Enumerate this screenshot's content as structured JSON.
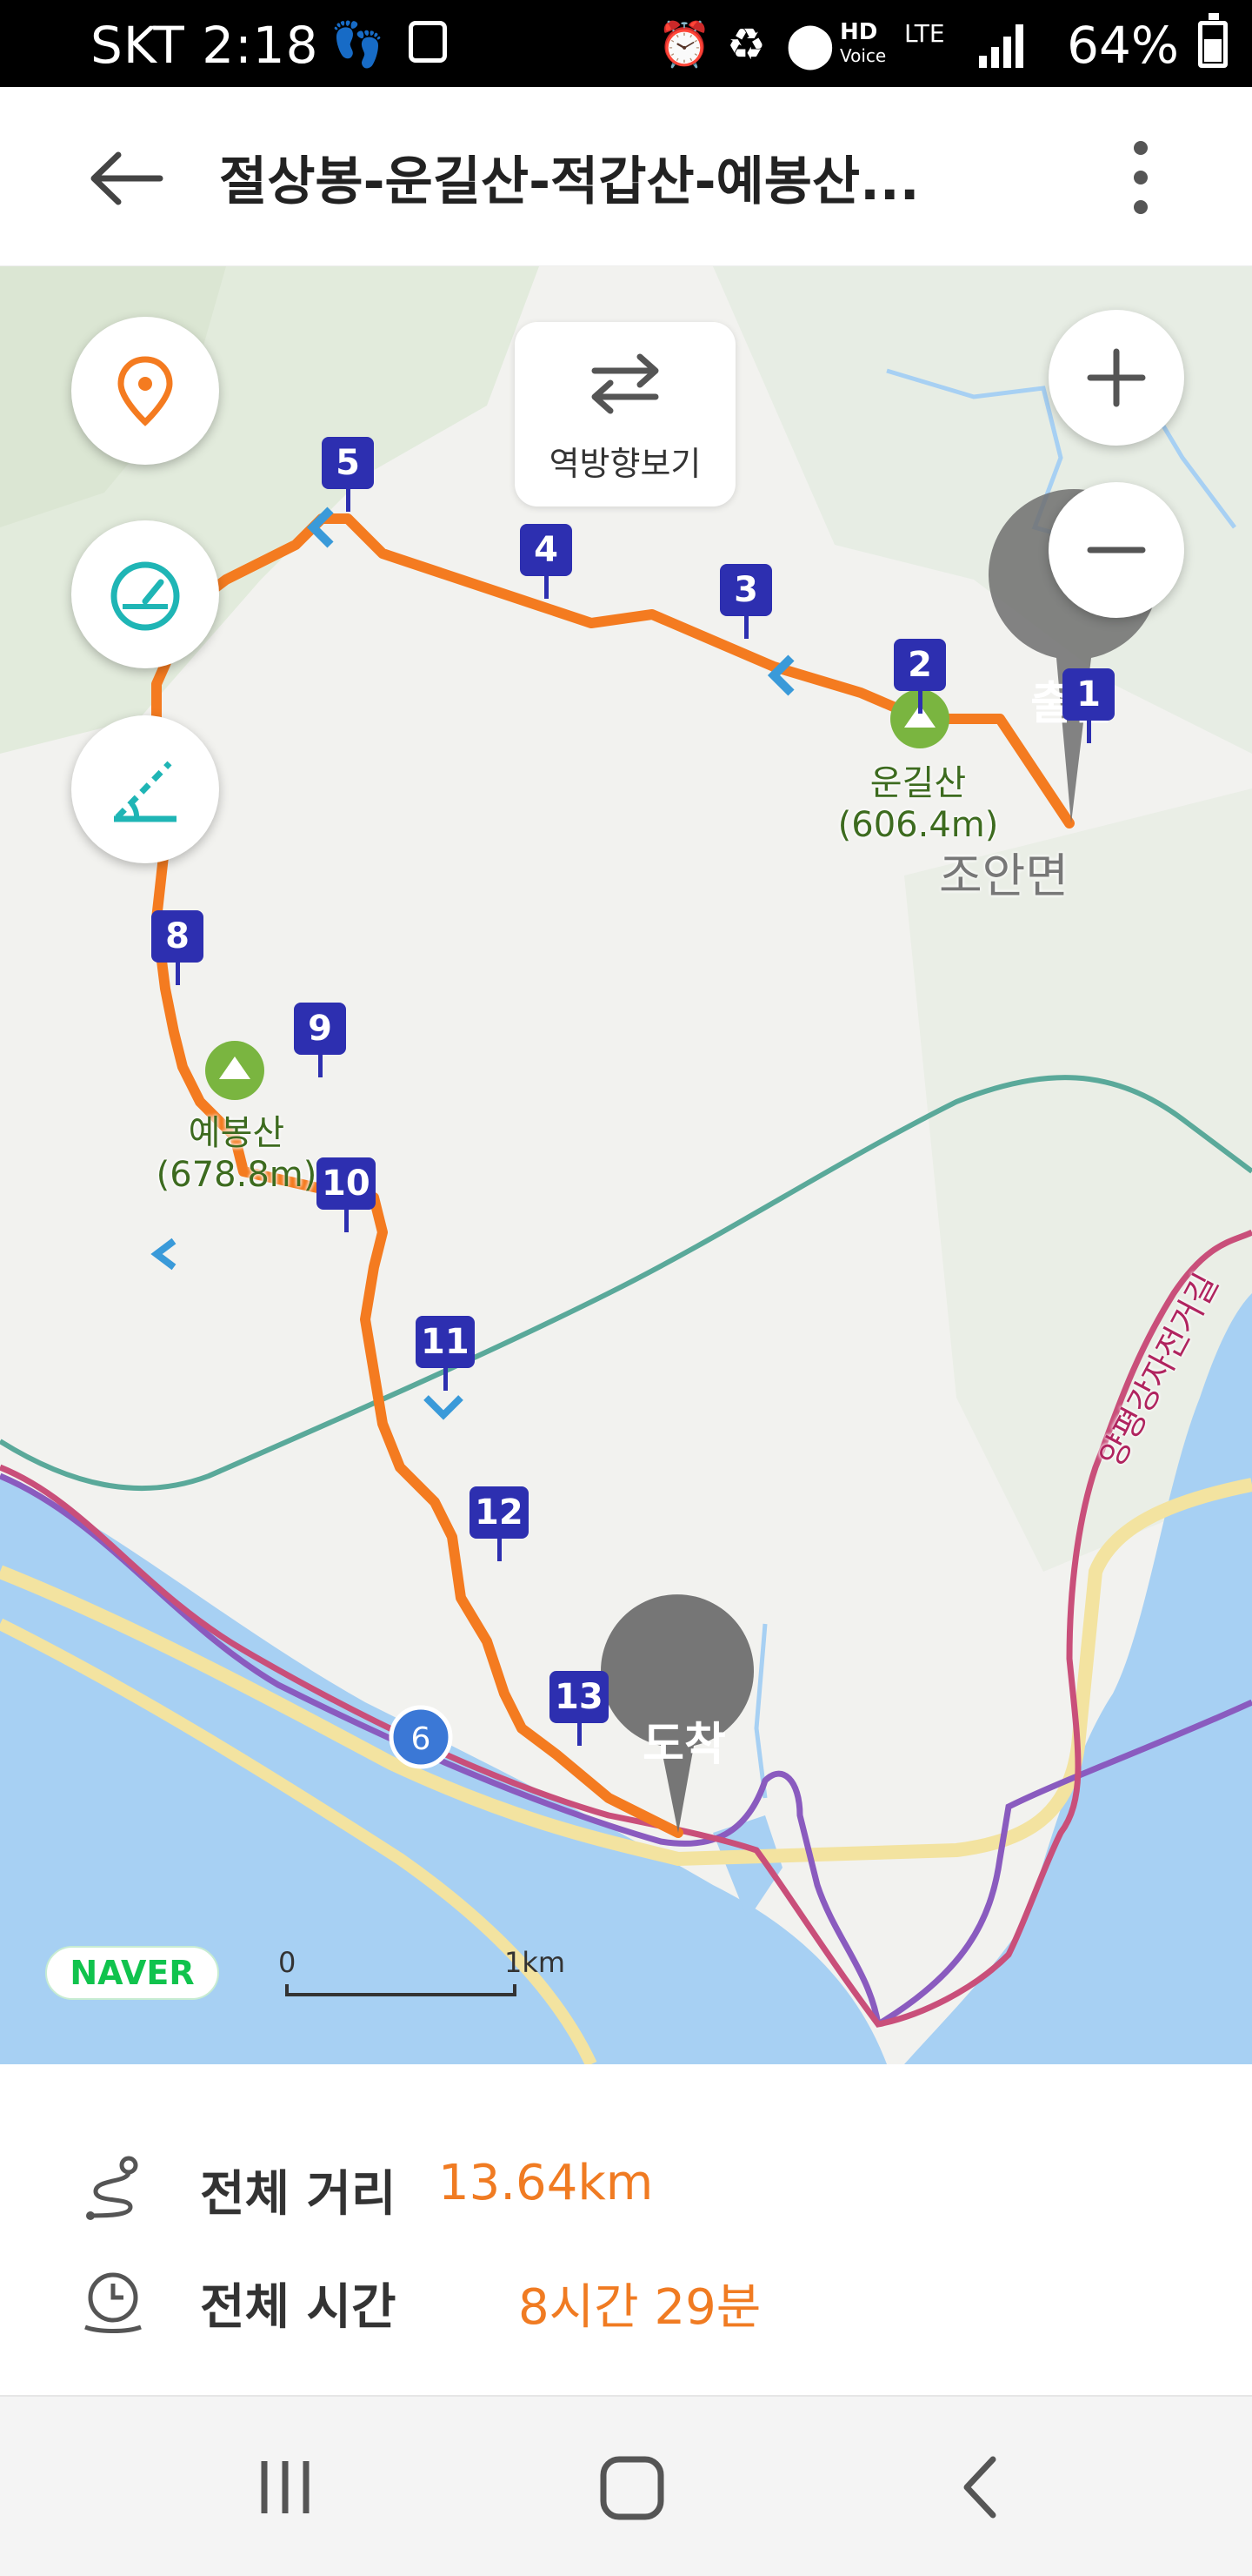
{
  "status_bar": {
    "carrier": "SKT",
    "time": "2:18",
    "network": "LTE",
    "hd_voice": "HD",
    "battery": "64%"
  },
  "app_bar": {
    "title": "절상봉-운길산-적갑산-예봉산..."
  },
  "map": {
    "reverse_button_label": "역방향보기",
    "reverse_icon": "swap-arrows-icon",
    "location_icon": "location-pin-icon",
    "speed_icon": "speedometer-icon",
    "elevation_icon": "slope-angle-icon",
    "zoom_in": "+",
    "zoom_out": "−",
    "waypoints": [
      "1",
      "2",
      "3",
      "4",
      "5",
      "8",
      "9",
      "10",
      "11",
      "12",
      "13"
    ],
    "peaks": [
      {
        "name": "운길산",
        "elevation": "(606.4m)"
      },
      {
        "name": "예봉산",
        "elevation": "(678.8m)"
      }
    ],
    "place": "조안면",
    "road_label": "양평강자전거길",
    "route_marker": "6",
    "start_pin": "출발",
    "end_pin": "도착",
    "brand": "NAVER",
    "scale_start": "0",
    "scale_end": "1km",
    "colors": {
      "route": "#f47b20",
      "waypoint": "#2d2fb0",
      "water": "#a7d0f3",
      "rail": "#5aa99a",
      "road_pink": "#c94f7a",
      "road_purple": "#8a5bbf",
      "road_yellow": "#f5e6a0"
    }
  },
  "summary": {
    "distance_label": "전체 거리",
    "distance_value": "13.64km",
    "time_label": "전체 시간",
    "time_value": "8시간 29분"
  },
  "nav_bar": {
    "recents_icon": "recent-apps-icon",
    "home_icon": "home-icon",
    "back_icon": "back-icon"
  }
}
